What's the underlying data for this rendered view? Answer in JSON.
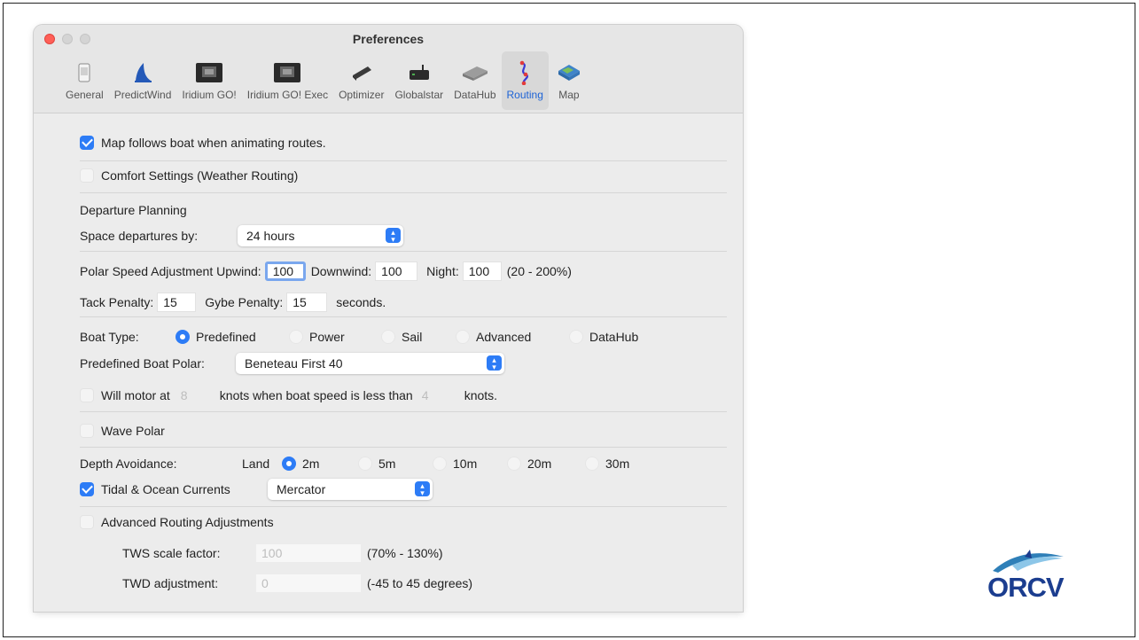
{
  "window": {
    "title": "Preferences"
  },
  "toolbar": {
    "items": [
      {
        "label": "General",
        "icon": "phone-icon"
      },
      {
        "label": "PredictWind",
        "icon": "sail-icon"
      },
      {
        "label": "Iridium GO!",
        "icon": "device-icon"
      },
      {
        "label": "Iridium GO! Exec",
        "icon": "device-icon"
      },
      {
        "label": "Optimizer",
        "icon": "optimizer-icon"
      },
      {
        "label": "Globalstar",
        "icon": "globalstar-icon"
      },
      {
        "label": "DataHub",
        "icon": "datahub-icon"
      },
      {
        "label": "Routing",
        "icon": "routing-icon",
        "selected": true
      },
      {
        "label": "Map",
        "icon": "map-icon"
      }
    ]
  },
  "routing": {
    "map_follows_label": "Map follows boat when animating routes.",
    "comfort_label": "Comfort Settings (Weather Routing)",
    "departure_heading": "Departure Planning",
    "space_label": "Space departures by:",
    "space_value": "24 hours",
    "polar_upwind_label": "Polar Speed Adjustment Upwind:",
    "polar_upwind_value": "100",
    "downwind_label": "Downwind:",
    "downwind_value": "100",
    "night_label": "Night:",
    "night_value": "100",
    "polar_range": "(20 - 200%)",
    "tack_label": "Tack Penalty:",
    "tack_value": "15",
    "gybe_label": "Gybe Penalty:",
    "gybe_value": "15",
    "seconds_label": "seconds.",
    "boat_type_label": "Boat Type:",
    "boat_types": [
      "Predefined",
      "Power",
      "Sail",
      "Advanced",
      "DataHub"
    ],
    "boat_type_selected": "Predefined",
    "polar_label": "Predefined Boat Polar:",
    "polar_value": "Beneteau First 40",
    "motor_label": "Will motor at",
    "motor_speed": "8",
    "motor_mid": "knots when boat speed is less than",
    "motor_threshold": "4",
    "motor_end": "knots.",
    "wave_polar_label": "Wave Polar",
    "depth_label": "Depth Avoidance:",
    "depth_options": [
      "Land",
      "2m",
      "5m",
      "10m",
      "20m",
      "30m"
    ],
    "depth_selected": "2m",
    "tidal_label": "Tidal & Ocean Currents",
    "tidal_value": "Mercator",
    "advanced_label": "Advanced Routing Adjustments",
    "tws_label": "TWS scale factor:",
    "tws_value": "100",
    "tws_range": "(70% - 130%)",
    "twd_label": "TWD adjustment:",
    "twd_value": "0",
    "twd_range": "(-45 to 45 degrees)"
  },
  "logo": {
    "text": "ORCV"
  },
  "colors": {
    "accent": "#2d7cf6",
    "close": "#ff5f57",
    "logo": "#1b3d8f"
  }
}
